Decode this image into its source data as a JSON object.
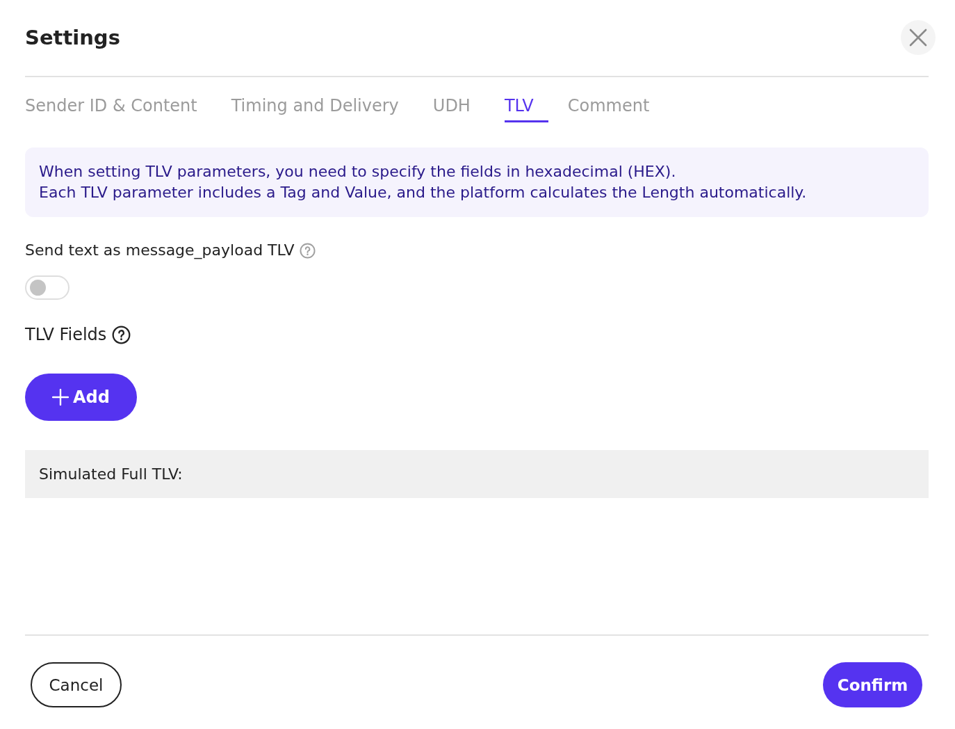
{
  "dialog": {
    "title": "Settings"
  },
  "tabs": [
    {
      "label": "Sender ID & Content",
      "selected": false
    },
    {
      "label": "Timing and Delivery",
      "selected": false
    },
    {
      "label": "UDH",
      "selected": false
    },
    {
      "label": "TLV",
      "selected": true
    },
    {
      "label": "Comment",
      "selected": false
    }
  ],
  "info_box": {
    "lines": [
      "When setting TLV parameters, you need to specify the fields in hexadecimal (HEX).",
      "Each TLV parameter includes a Tag and Value, and the platform calculates the Length automatically."
    ]
  },
  "payload_toggle": {
    "label": "Send text as message_payload TLV",
    "on": false
  },
  "tlv_fields": {
    "label": "TLV Fields",
    "add_button": "Add"
  },
  "simulated": {
    "label": "Simulated Full TLV:"
  },
  "footer": {
    "buttons": [
      {
        "label": "Cancel",
        "kind": "secondary"
      },
      {
        "label": "Confirm",
        "kind": "primary"
      }
    ]
  }
}
